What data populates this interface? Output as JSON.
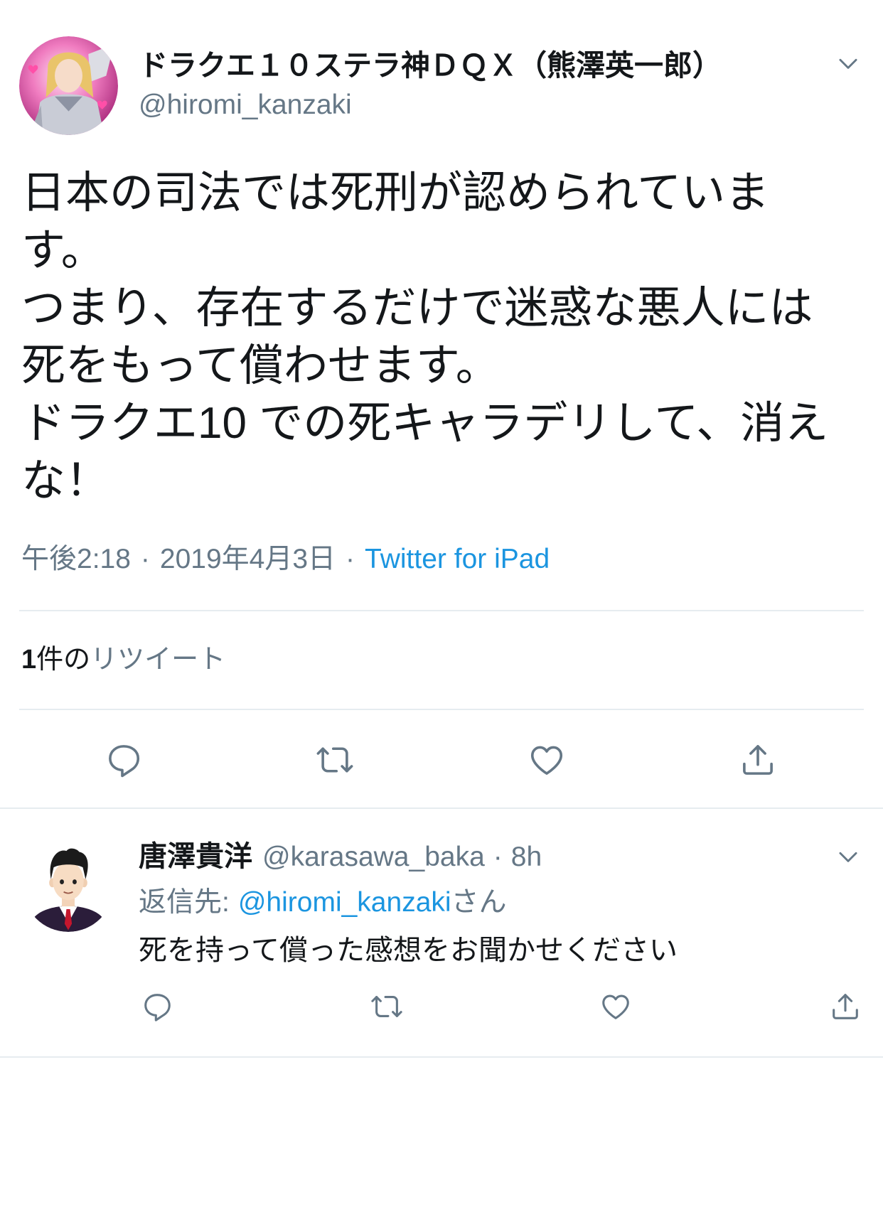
{
  "colors": {
    "text": "#14171a",
    "secondary": "#657786",
    "link": "#1b95e0",
    "divider": "#e6ecf0",
    "icon": "#657786"
  },
  "icons": {
    "menu": "chevron-down-icon",
    "reply": "reply-icon",
    "retweet": "retweet-icon",
    "like": "heart-icon",
    "share": "share-icon"
  },
  "tweet": {
    "author": {
      "display_name": "ドラクエ１０ステラ神ＤＱＸ（熊澤英一郎）",
      "handle": "@hiromi_kanzaki"
    },
    "text_lines": [
      "日本の司法では死刑が認められていま",
      "す。",
      "つまり、存在するだけで迷惑な悪人には",
      "死をもって償わせます。",
      "ドラクエ10 での死キャラデリして、消え",
      "な！"
    ],
    "meta": {
      "time": "午後2:18",
      "separator": "·",
      "date": "2019年4月3日",
      "source": "Twitter for iPad"
    },
    "retweets": {
      "count": "1",
      "unit": "件の",
      "label": "リツイート"
    }
  },
  "reply": {
    "author": {
      "display_name": "唐澤貴洋",
      "handle": "@karasawa_baka",
      "separator": "·",
      "age": "8h"
    },
    "replying_to": {
      "prefix": "返信先:",
      "handle": "@hiromi_kanzaki",
      "suffix": "さん"
    },
    "text": "死を持って償った感想をお聞かせください"
  }
}
